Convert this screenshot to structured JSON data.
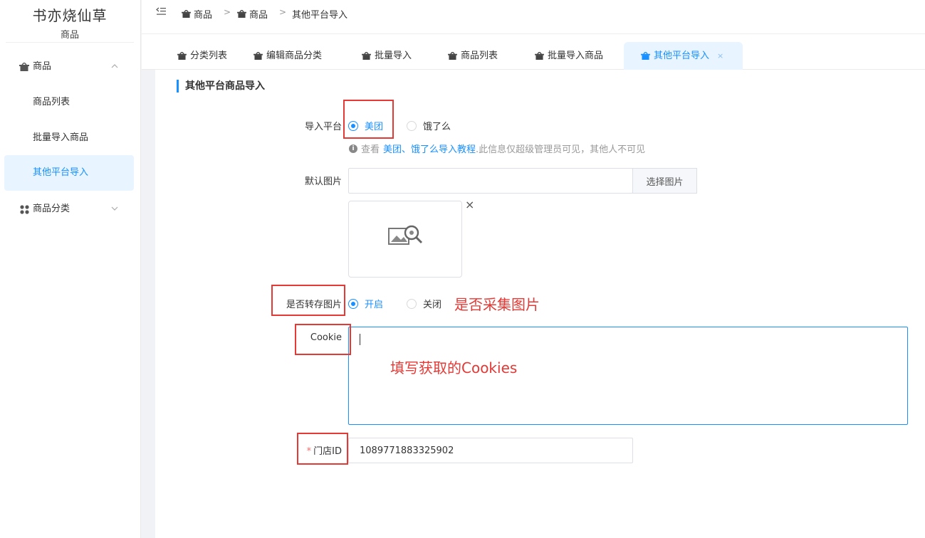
{
  "sidebar": {
    "brand": "书亦烧仙草",
    "brand_sub": "商品",
    "menu": [
      {
        "label": "商品",
        "icon": "basket-icon",
        "chevron": "^"
      },
      {
        "label": "商品分类",
        "icon": "grid-icon",
        "chevron": "v"
      }
    ],
    "submenu": [
      {
        "label": "商品列表"
      },
      {
        "label": "批量导入商品"
      },
      {
        "label": "其他平台导入"
      }
    ]
  },
  "header": {
    "fold_icon": "menu-fold-icon",
    "breadcrumb": [
      "商品",
      "商品",
      "其他平台导入"
    ],
    "separator": ">"
  },
  "tabs": [
    {
      "label": "分类列表"
    },
    {
      "label": "编辑商品分类"
    },
    {
      "label": "批量导入"
    },
    {
      "label": "商品列表"
    },
    {
      "label": "批量导入商品"
    },
    {
      "label": "其他平台导入",
      "close": "×"
    }
  ],
  "form": {
    "section_title": "其他平台商品导入",
    "platform": {
      "label": "导入平台",
      "options": [
        "美团",
        "饿了么"
      ],
      "selected": "美团",
      "hint_prefix": "查看",
      "hint_link": "美团、饿了么导入教程",
      "hint_suffix": ".此信息仅超级管理员可见，其他人不可见"
    },
    "default_image": {
      "label": "默认图片",
      "value": "",
      "button": "选择图片",
      "remove": "×"
    },
    "save_image": {
      "label": "是否转存图片",
      "options": [
        "开启",
        "关闭"
      ],
      "selected": "开启"
    },
    "cookie": {
      "label": "Cookie",
      "value": ""
    },
    "store_id": {
      "required_mark": "*",
      "label": "门店ID",
      "value": "1089771883325902"
    }
  },
  "annotations": {
    "save_image_note": "是否采集图片",
    "cookie_note": "填写获取的Cookies"
  },
  "colors": {
    "primary": "#1890ff",
    "annotation": "#e53935",
    "active_bg": "#e8f4ff"
  }
}
